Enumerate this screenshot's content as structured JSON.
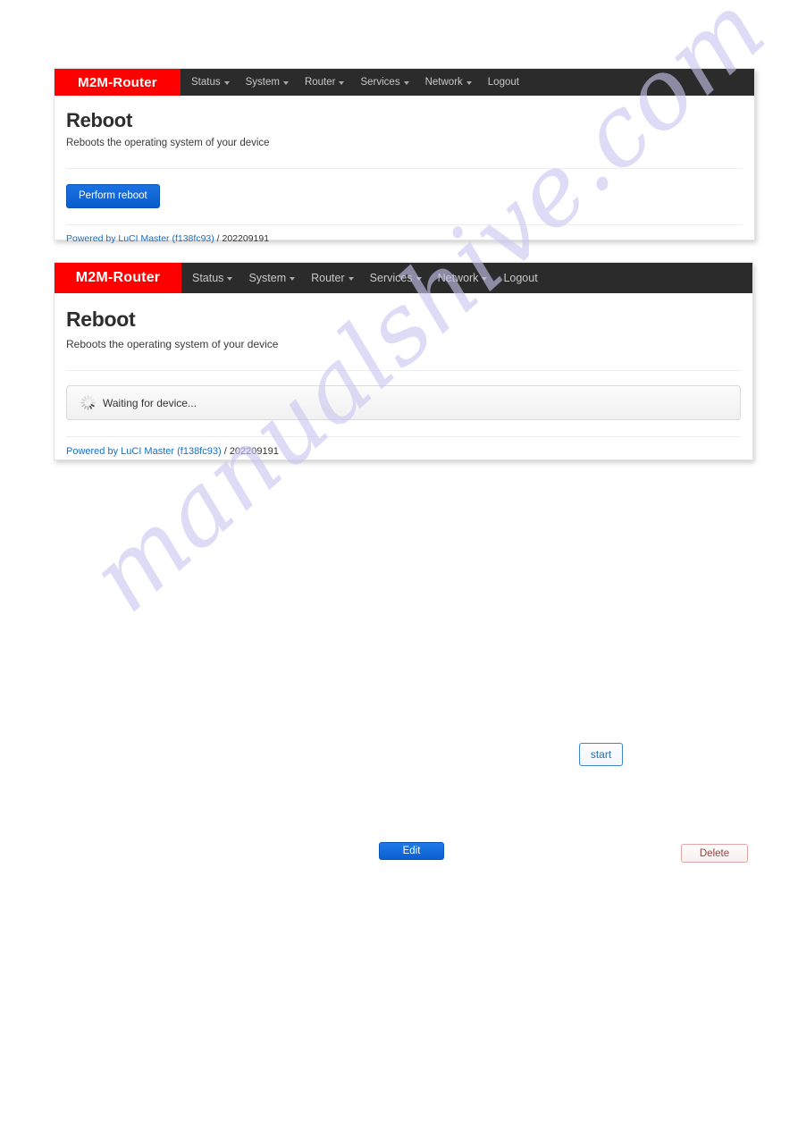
{
  "brand": {
    "name": "M2M-Router",
    "color": "#ff0000"
  },
  "nav": {
    "items": [
      {
        "label": "Status",
        "has_caret": true
      },
      {
        "label": "System",
        "has_caret": true
      },
      {
        "label": "Router",
        "has_caret": true
      },
      {
        "label": "Services",
        "has_caret": true
      },
      {
        "label": "Network",
        "has_caret": true
      },
      {
        "label": "Logout",
        "has_caret": false
      }
    ]
  },
  "panel_top": {
    "title": "Reboot",
    "subtitle": "Reboots the operating system of your device",
    "perform_reboot_label": "Perform reboot",
    "footer": {
      "link_text": "Powered by LuCI Master (f138fc93)",
      "separator": " / ",
      "build": "202209191"
    }
  },
  "panel_bottom": {
    "title": "Reboot",
    "subtitle": "Reboots the operating system of your device",
    "waiting_text": "Waiting for device...",
    "spinner_icon": "loading-spinner-icon",
    "footer": {
      "link_text": "Powered by LuCI Master (f138fc93)",
      "separator": " / ",
      "build": "202209191"
    }
  },
  "loose_buttons": {
    "start": "start",
    "edit": "Edit",
    "delete": "Delete"
  },
  "watermark": {
    "text": "manualshive.com",
    "color": "#c9c6ef"
  }
}
